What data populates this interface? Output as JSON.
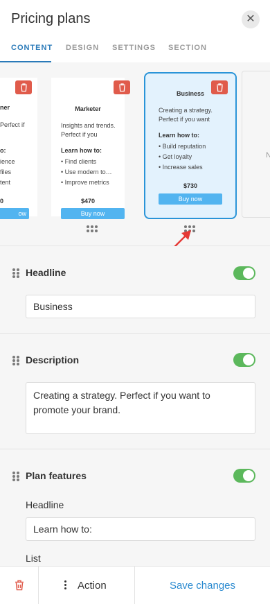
{
  "header": {
    "title": "Pricing plans",
    "close_icon": "close-icon",
    "tabs": [
      "CONTENT",
      "DESIGN",
      "SETTINGS",
      "SECTION"
    ],
    "active_tab": "CONTENT"
  },
  "carousel": {
    "cards": [
      {
        "name": "ner",
        "desc": "Perfect if",
        "learn": "o:",
        "features": [
          "ience",
          "files",
          "tent"
        ],
        "price": "0",
        "buy": "ow"
      },
      {
        "name": "Marketer",
        "desc": "Insights and trends. Perfect if you",
        "learn": "Learn how to:",
        "features": [
          "• Find clients",
          "• Use modern to…",
          "• Improve metrics"
        ],
        "price": "$470",
        "buy": "Buy now"
      },
      {
        "name": "Business",
        "desc": "Creating a strategy. Perfect if you want",
        "learn": "Learn how to:",
        "features": [
          "• Build reputation",
          "• Get loyalty",
          "• Increase sales"
        ],
        "price": "$730",
        "buy": "Buy now",
        "selected": true
      }
    ],
    "ghost_letter": "N",
    "colors": {
      "selected_border": "#2a94d8",
      "delete": "#e05b4b",
      "buy": "#52b4f0"
    }
  },
  "sections": {
    "headline": {
      "title": "Headline",
      "value": "Business",
      "enabled": true
    },
    "description": {
      "title": "Description",
      "value": "Creating a strategy. Perfect if you want to promote your brand.",
      "enabled": true
    },
    "features": {
      "title": "Plan features",
      "headline_label": "Headline",
      "headline_value": "Learn how to:",
      "list_label": "List",
      "enabled": true
    }
  },
  "footer": {
    "action_label": "Action",
    "save_label": "Save changes"
  },
  "colors": {
    "accent": "#2a7ab9",
    "toggle_on": "#5cb85c",
    "trash": "#e05b4b"
  }
}
